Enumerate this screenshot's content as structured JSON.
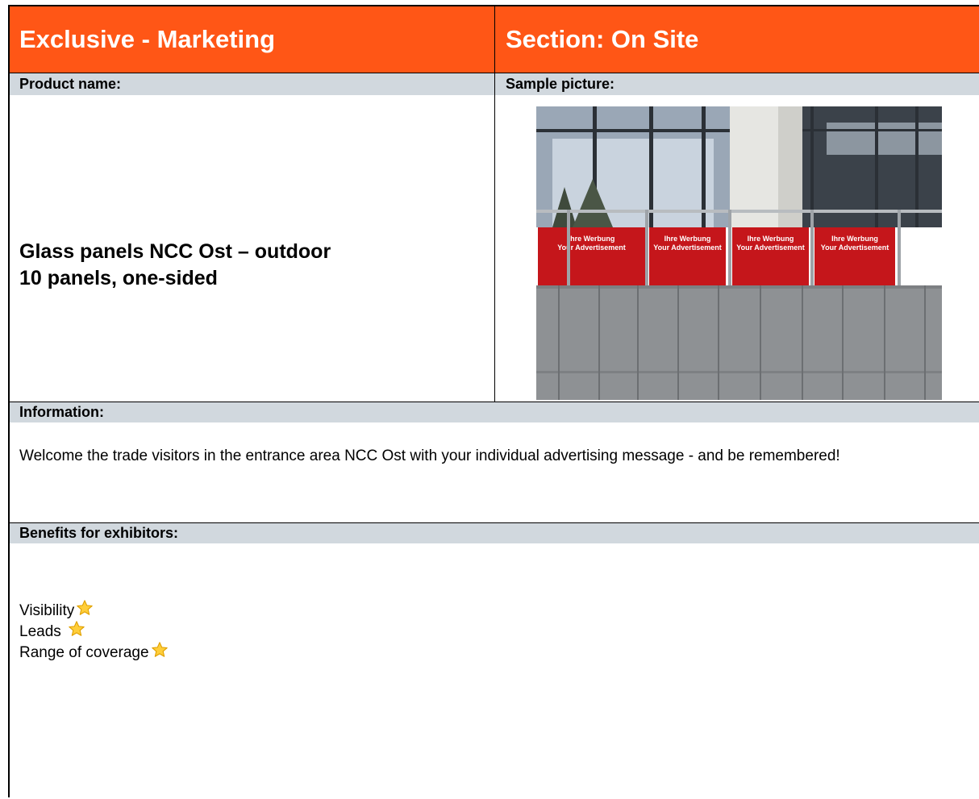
{
  "header": {
    "left_title": "Exclusive - Marketing",
    "right_title": "Section: On Site",
    "accent": "#ff5616",
    "band_color": "#d1d8de"
  },
  "product": {
    "label": "Product name:",
    "name_line1": "Glass panels NCC Ost – outdoor",
    "name_line2": "10 panels, one-sided"
  },
  "sample": {
    "label": "Sample picture:",
    "panel_text_line1": "Ihre Werbung",
    "panel_text_line2": "Your Advertisement",
    "panel_color": "#c5161b"
  },
  "information": {
    "label": "Information:",
    "text": "Welcome the trade visitors in the entrance area NCC Ost with your individual advertising message - and be remembered!"
  },
  "benefits": {
    "label": "Benefits for exhibitors:",
    "items": [
      {
        "label": "Visibility",
        "icon": "star-icon"
      },
      {
        "label": "Leads",
        "icon": "star-icon"
      },
      {
        "label": "Range of coverage",
        "icon": "star-icon"
      }
    ]
  }
}
